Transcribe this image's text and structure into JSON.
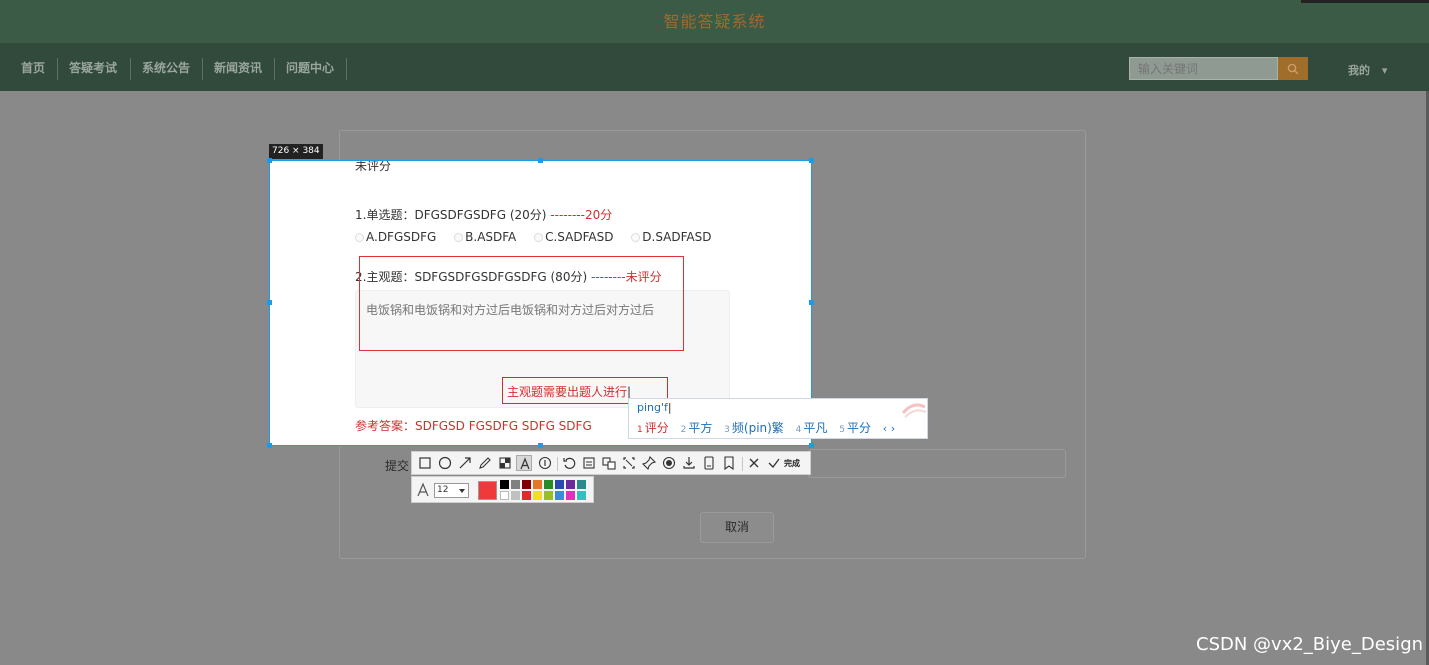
{
  "header": {
    "title": "智能答疑系统"
  },
  "nav": {
    "items": [
      {
        "label": "首页"
      },
      {
        "label": "答疑考试"
      },
      {
        "label": "系统公告"
      },
      {
        "label": "新闻资讯"
      },
      {
        "label": "问题中心"
      }
    ],
    "search_placeholder": "输入关键词",
    "user_menu": "我的"
  },
  "capture": {
    "size_badge": "726 × 384"
  },
  "exam": {
    "status": "未评分",
    "q1": {
      "title": "1.单选题：DFGSDFGSDFG (20分)",
      "score": "--------20分",
      "options": [
        "A.DFGSDFG",
        "B.ASDFA",
        "C.SADFASD",
        "D.SADFASD"
      ]
    },
    "q2": {
      "title": "2.主观题：SDFGSDFGSDFGSDFG (80分)",
      "score": "--------未评分",
      "answer": "电饭锅和电饭锅和对方过后电饭锅和对方过后对方过后"
    },
    "reference": "参考答案：SDFGSD FGSDFG SDFG SDFG",
    "submit_label": "提交",
    "cancel": "取消"
  },
  "annotation": {
    "text": "主观题需要出题人进行"
  },
  "ime": {
    "input": "ping'f",
    "candidates": [
      {
        "num": "1",
        "text": "评分"
      },
      {
        "num": "2",
        "text": "平方"
      },
      {
        "num": "3",
        "text": "频(pin)繁"
      },
      {
        "num": "4",
        "text": "平凡"
      },
      {
        "num": "5",
        "text": "平分"
      }
    ],
    "arrows": "‹ ›"
  },
  "toolbar": {
    "done_label": "完成",
    "font_size": "12",
    "current_color": "#f03a3a",
    "palette": [
      "#000000",
      "#808080",
      "#800000",
      "#e07a2a",
      "#2a8a2a",
      "#2a4ab0",
      "#6a2a9a",
      "#2a8a8a",
      "#ffffff",
      "#c0c0c0",
      "#e02a2a",
      "#f0e020",
      "#9ac020",
      "#3a8ae0",
      "#e030c0",
      "#30c0c0"
    ]
  },
  "watermark": "CSDN @vx2_Biye_Design",
  "colors": {
    "header_bg": "#3c5b47",
    "nav_bg": "#324a3b",
    "accent": "#a06d2a",
    "selection": "#1e9be8",
    "annotation": "#d0302d"
  }
}
